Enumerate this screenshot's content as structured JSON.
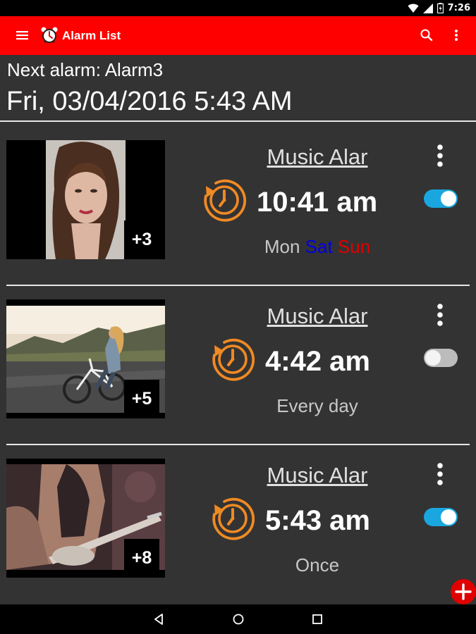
{
  "status_bar": {
    "time": "7:26",
    "icons": [
      "wifi-icon",
      "signal-icon",
      "battery-icon"
    ]
  },
  "app_bar": {
    "title": "Alarm List",
    "icons": {
      "menu": "hamburger-menu-icon",
      "logo": "alarm-clock-icon",
      "search": "search-icon",
      "overflow": "more-vert-icon"
    },
    "color": "#ff0000"
  },
  "header": {
    "next_alarm_label": "Next alarm: Alarm3",
    "next_alarm_datetime": "Fri, 03/04/2016 5:43 AM"
  },
  "alarms": [
    {
      "name": "Music Alar",
      "time": "10:41 am",
      "enabled": true,
      "image_count": "+3",
      "days": [
        {
          "text": "Mon",
          "style": "normal"
        },
        {
          "text": " ",
          "style": "normal"
        },
        {
          "text": "Sat",
          "style": "sat"
        },
        {
          "text": " ",
          "style": "normal"
        },
        {
          "text": "Sun",
          "style": "sun"
        }
      ]
    },
    {
      "name": "Music Alar",
      "time": "4:42 am",
      "enabled": false,
      "image_count": "+5",
      "days": [
        {
          "text": "Every day",
          "style": "normal"
        }
      ]
    },
    {
      "name": "Music Alar",
      "time": "5:43 am",
      "enabled": true,
      "image_count": "+8",
      "days": [
        {
          "text": "Once",
          "style": "normal"
        }
      ]
    }
  ],
  "colors": {
    "accent": "#f08a24",
    "toggle_on": "#1aa7df",
    "saturday": "#0000e6",
    "sunday": "#e00000",
    "background": "#333333"
  },
  "fab": {
    "icon": "add-icon"
  },
  "nav_bar": {
    "icons": [
      "back-icon",
      "home-icon",
      "recents-icon"
    ]
  }
}
